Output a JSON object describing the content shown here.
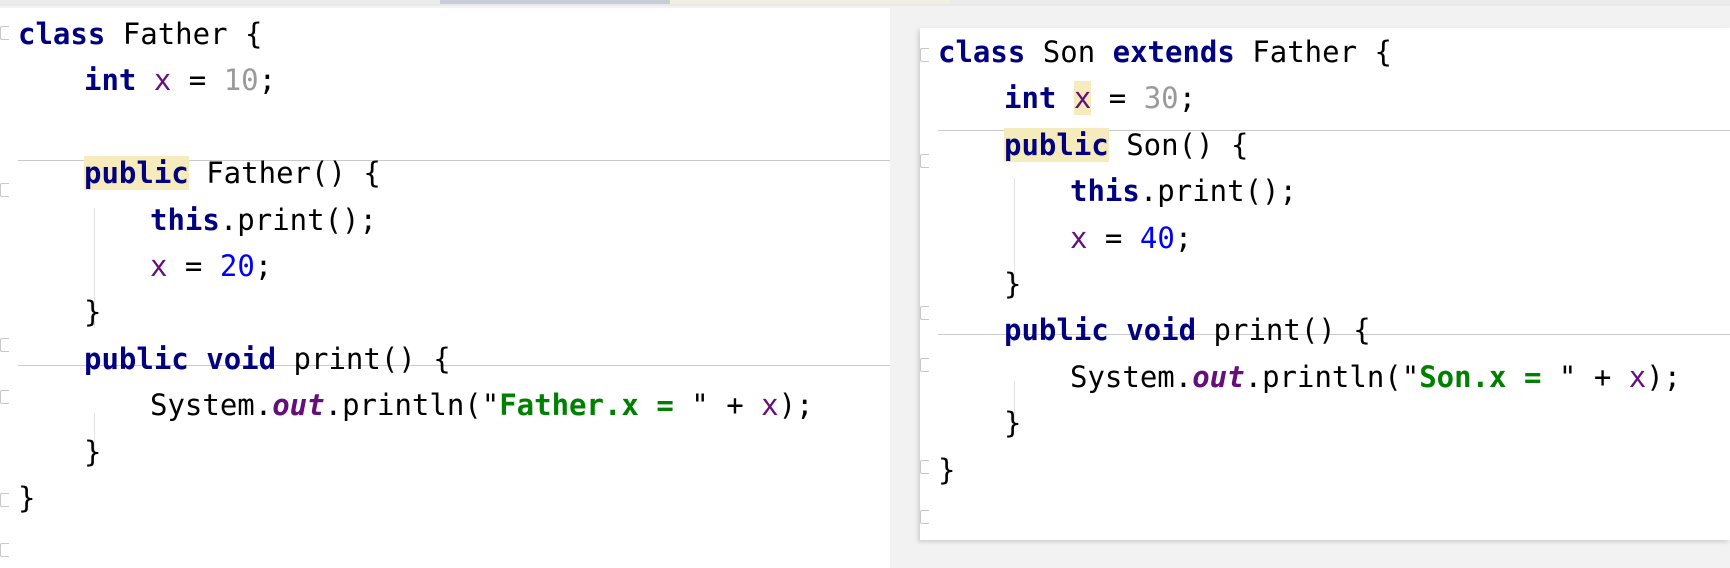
{
  "father": {
    "lines": [
      [
        {
          "t": "class",
          "c": "kw"
        },
        {
          "t": " Father {",
          "c": ""
        }
      ],
      [
        {
          "t": "int",
          "c": "kw"
        },
        {
          "t": " ",
          "c": ""
        },
        {
          "t": "x",
          "c": "fld"
        },
        {
          "t": " = ",
          "c": ""
        },
        {
          "t": "10",
          "c": "num-dim"
        },
        {
          "t": ";",
          "c": ""
        }
      ],
      [],
      [
        {
          "t": "public",
          "c": "kw hl"
        },
        {
          "t": " Father() {",
          "c": ""
        }
      ],
      [
        {
          "t": "this",
          "c": "kw"
        },
        {
          "t": ".print();",
          "c": ""
        }
      ],
      [
        {
          "t": "x",
          "c": "fld"
        },
        {
          "t": " = ",
          "c": ""
        },
        {
          "t": "20",
          "c": "num"
        },
        {
          "t": ";",
          "c": ""
        }
      ],
      [
        {
          "t": "}",
          "c": ""
        }
      ],
      [
        {
          "t": "public",
          "c": "kw"
        },
        {
          "t": " ",
          "c": ""
        },
        {
          "t": "void",
          "c": "kw"
        },
        {
          "t": " print() {",
          "c": ""
        }
      ],
      [
        {
          "t": "System.",
          "c": ""
        },
        {
          "t": "out",
          "c": "stat"
        },
        {
          "t": ".println(\"",
          "c": ""
        },
        {
          "t": "Father.x = ",
          "c": "str"
        },
        {
          "t": "\" + ",
          "c": ""
        },
        {
          "t": "x",
          "c": "fld"
        },
        {
          "t": ");",
          "c": ""
        }
      ],
      [
        {
          "t": "}",
          "c": ""
        }
      ],
      [
        {
          "t": "}",
          "c": ""
        }
      ]
    ]
  },
  "son": {
    "lines": [
      [
        {
          "t": "class",
          "c": "kw"
        },
        {
          "t": " Son ",
          "c": ""
        },
        {
          "t": "extends",
          "c": "kw"
        },
        {
          "t": " Father {",
          "c": ""
        }
      ],
      [
        {
          "t": "int",
          "c": "kw"
        },
        {
          "t": " ",
          "c": ""
        },
        {
          "t": "x",
          "c": "fld hl"
        },
        {
          "t": " = ",
          "c": ""
        },
        {
          "t": "30",
          "c": "num-dim"
        },
        {
          "t": ";",
          "c": ""
        }
      ],
      [
        {
          "t": "public",
          "c": "kw hl"
        },
        {
          "t": " Son() {",
          "c": ""
        }
      ],
      [
        {
          "t": "this",
          "c": "kw"
        },
        {
          "t": ".print();",
          "c": ""
        }
      ],
      [
        {
          "t": "x",
          "c": "fld"
        },
        {
          "t": " = ",
          "c": ""
        },
        {
          "t": "40",
          "c": "num"
        },
        {
          "t": ";",
          "c": ""
        }
      ],
      [
        {
          "t": "}",
          "c": ""
        }
      ],
      [
        {
          "t": "public",
          "c": "kw"
        },
        {
          "t": " ",
          "c": ""
        },
        {
          "t": "void",
          "c": "kw"
        },
        {
          "t": " print() {",
          "c": ""
        }
      ],
      [
        {
          "t": "System.",
          "c": ""
        },
        {
          "t": "out",
          "c": "stat"
        },
        {
          "t": ".println(\"",
          "c": ""
        },
        {
          "t": "Son.x = ",
          "c": "str"
        },
        {
          "t": "\" + ",
          "c": ""
        },
        {
          "t": "x",
          "c": "fld"
        },
        {
          "t": ");",
          "c": ""
        }
      ],
      [
        {
          "t": "}",
          "c": ""
        }
      ],
      [
        {
          "t": "}",
          "c": ""
        }
      ]
    ]
  }
}
